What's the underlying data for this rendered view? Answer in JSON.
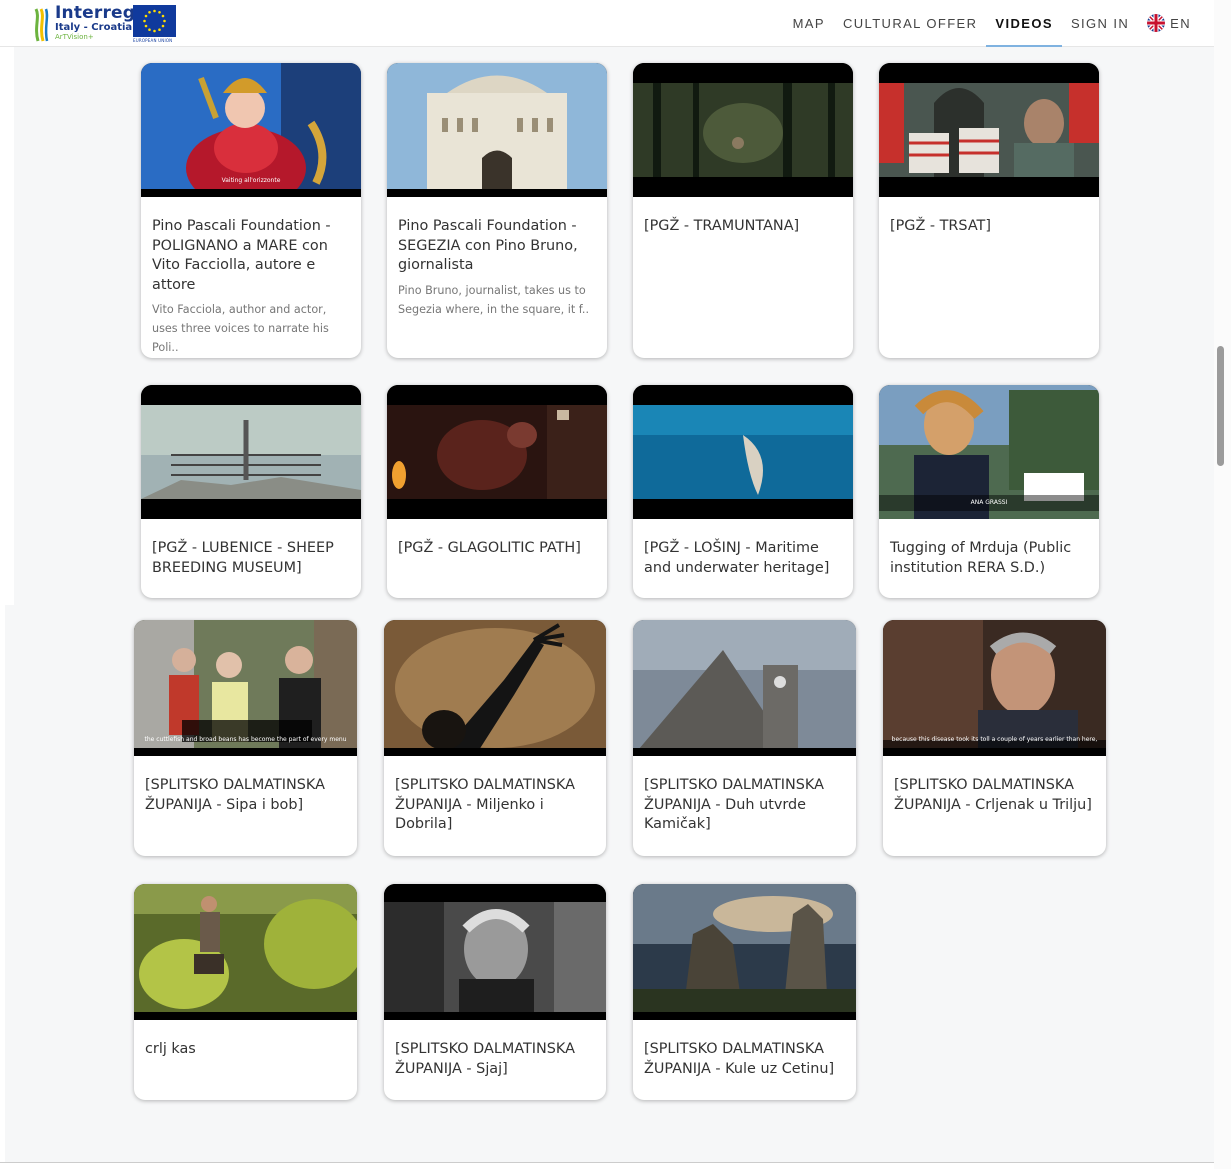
{
  "logo": {
    "name": "Interreg",
    "subtitle": "Italy - Croatia",
    "project": "ArTVision+",
    "eu_label": "EUROPEAN UNION"
  },
  "nav": {
    "items": [
      {
        "label": "MAP",
        "active": false
      },
      {
        "label": "CULTURAL OFFER",
        "active": false
      },
      {
        "label": "VIDEOS",
        "active": true
      },
      {
        "label": "SIGN IN",
        "active": false
      }
    ],
    "language": "EN"
  },
  "videos": [
    {
      "title": "Pino Pascali Foundation - POLIGNANO a MARE con Vito Facciolla, autore e attore",
      "description": "Vito Facciola, author and actor, uses three voices to narrate his Poli..",
      "thumb_caption": "Vaiting all'orizzonte"
    },
    {
      "title": "Pino Pascali Foundation - SEGEZIA con Pino Bruno, giornalista",
      "description": "Pino Bruno, journalist, takes us to Segezia where, in the square, it f..",
      "thumb_caption": ""
    },
    {
      "title": "[PGŽ - TRAMUNTANA]",
      "description": "",
      "thumb_caption": ""
    },
    {
      "title": "[PGŽ - TRSAT]",
      "description": "",
      "thumb_caption": ""
    },
    {
      "title": "[PGŽ - LUBENICE - SHEEP BREEDING MUSEUM]",
      "description": "",
      "thumb_caption": ""
    },
    {
      "title": "[PGŽ - GLAGOLITIC PATH]",
      "description": "",
      "thumb_caption": ""
    },
    {
      "title": "[PGŽ - LOŠINJ - Maritime and underwater heritage]",
      "description": "",
      "thumb_caption": ""
    },
    {
      "title": "Tugging of Mrduja (Public institution RERA S.D.)",
      "description": "",
      "thumb_caption": "ANA GRASSI"
    },
    {
      "title": "[SPLITSKO DALMATINSKA ŽUPANIJA - Sipa i bob]",
      "description": "",
      "thumb_caption": "the cuttlefish and broad beans has become the part of every menu"
    },
    {
      "title": "[SPLITSKO DALMATINSKA ŽUPANIJA - Miljenko i Dobrila]",
      "description": "",
      "thumb_caption": ""
    },
    {
      "title": "[SPLITSKO DALMATINSKA ŽUPANIJA - Duh utvrde Kamičak]",
      "description": "",
      "thumb_caption": ""
    },
    {
      "title": "[SPLITSKO DALMATINSKA ŽUPANIJA - Crljenak u Trilju]",
      "description": "",
      "thumb_caption": "because this disease took its toll a couple of years earlier than here,"
    },
    {
      "title": "crlj kas",
      "description": "",
      "thumb_caption": ""
    },
    {
      "title": "[SPLITSKO DALMATINSKA ŽUPANIJA - Sjaj]",
      "description": "",
      "thumb_caption": ""
    },
    {
      "title": "[SPLITSKO DALMATINSKA ŽUPANIJA - Kule uz Cetinu]",
      "description": "",
      "thumb_caption": ""
    }
  ],
  "colors": {
    "brand_blue": "#1a3a8a",
    "nav_active_underline": "#7fb2e0",
    "page_background": "#f6f7f8"
  }
}
